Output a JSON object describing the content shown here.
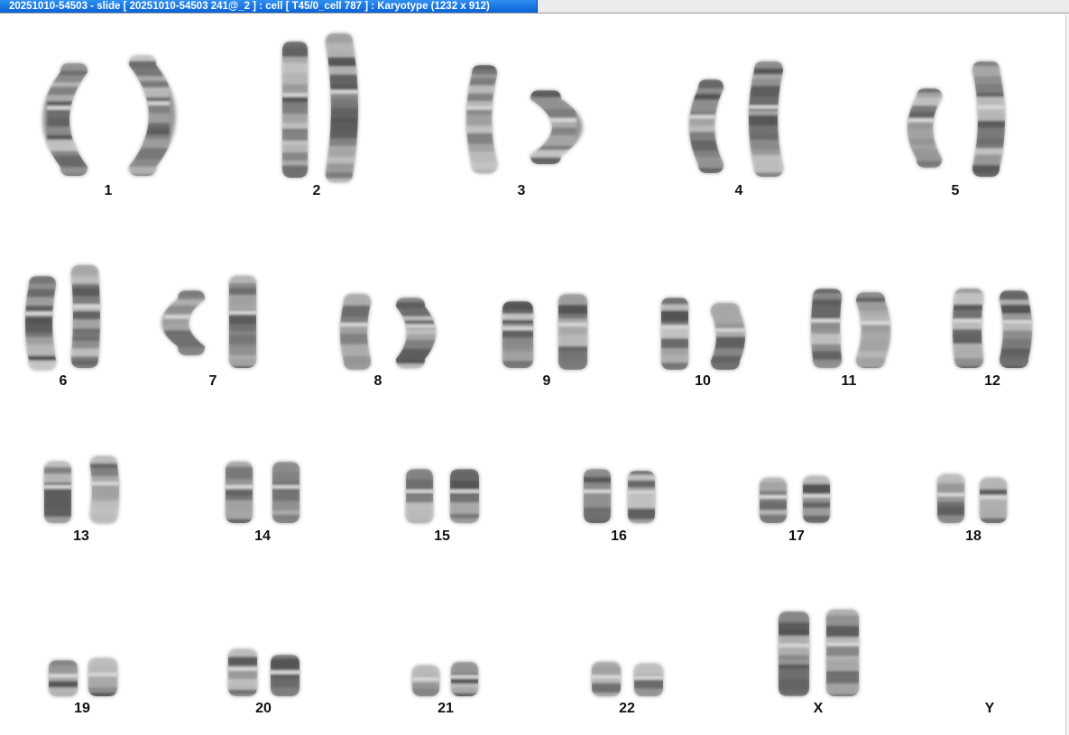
{
  "window": {
    "title": "20251010-54503 - slide [ 20251010-54503 241@_2 ] : cell [ T45/0_cell 787 ] : Karyotype  (1232 x 912)"
  },
  "karyotype": {
    "chromosomes": [
      {
        "label": "1",
        "count": 2
      },
      {
        "label": "2",
        "count": 2
      },
      {
        "label": "3",
        "count": 2
      },
      {
        "label": "4",
        "count": 2
      },
      {
        "label": "5",
        "count": 2
      },
      {
        "label": "6",
        "count": 2
      },
      {
        "label": "7",
        "count": 2
      },
      {
        "label": "8",
        "count": 2
      },
      {
        "label": "9",
        "count": 2
      },
      {
        "label": "10",
        "count": 2
      },
      {
        "label": "11",
        "count": 2
      },
      {
        "label": "12",
        "count": 2
      },
      {
        "label": "13",
        "count": 2
      },
      {
        "label": "14",
        "count": 2
      },
      {
        "label": "15",
        "count": 2
      },
      {
        "label": "16",
        "count": 2
      },
      {
        "label": "17",
        "count": 2
      },
      {
        "label": "18",
        "count": 2
      },
      {
        "label": "19",
        "count": 2
      },
      {
        "label": "20",
        "count": 2
      },
      {
        "label": "21",
        "count": 2
      },
      {
        "label": "22",
        "count": 2
      },
      {
        "label": "X",
        "count": 2
      },
      {
        "label": "Y",
        "count": 0
      }
    ]
  }
}
